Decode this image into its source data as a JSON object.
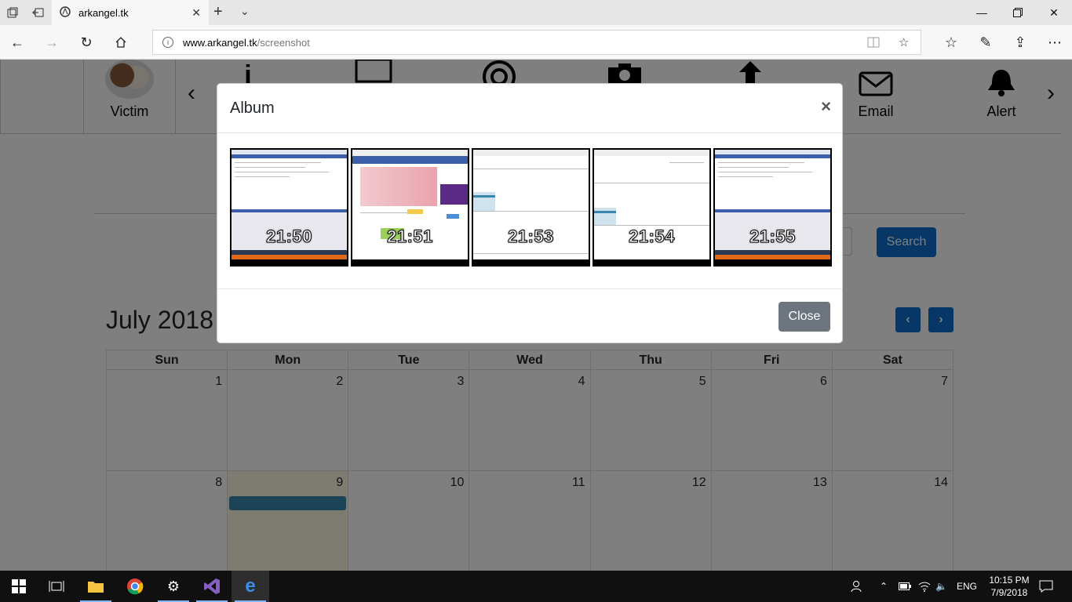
{
  "browser": {
    "tab_title": "arkangel.tk",
    "url_domain": "www.arkangel.tk",
    "url_path": "/screenshot"
  },
  "menu": {
    "victim_label": "Victim",
    "email_label": "Email",
    "alert_label": "Alert"
  },
  "search": {
    "button_label": "Search"
  },
  "calendar": {
    "month_title": "July 2018",
    "weekdays": [
      "Sun",
      "Mon",
      "Tue",
      "Wed",
      "Thu",
      "Fri",
      "Sat"
    ],
    "week1": [
      "1",
      "2",
      "3",
      "4",
      "5",
      "6",
      "7"
    ],
    "week2": [
      "8",
      "9",
      "10",
      "11",
      "12",
      "13",
      "14"
    ]
  },
  "modal": {
    "title": "Album",
    "close_x": "×",
    "close_label": "Close",
    "thumbnails": [
      "21:50",
      "21:51",
      "21:53",
      "21:54",
      "21:55"
    ]
  },
  "taskbar": {
    "lang": "ENG",
    "time": "10:15 PM",
    "date": "7/9/2018"
  },
  "colors": {
    "primary": "#0d6ecd",
    "secondary": "#6c757d",
    "event": "#3a87ad"
  }
}
